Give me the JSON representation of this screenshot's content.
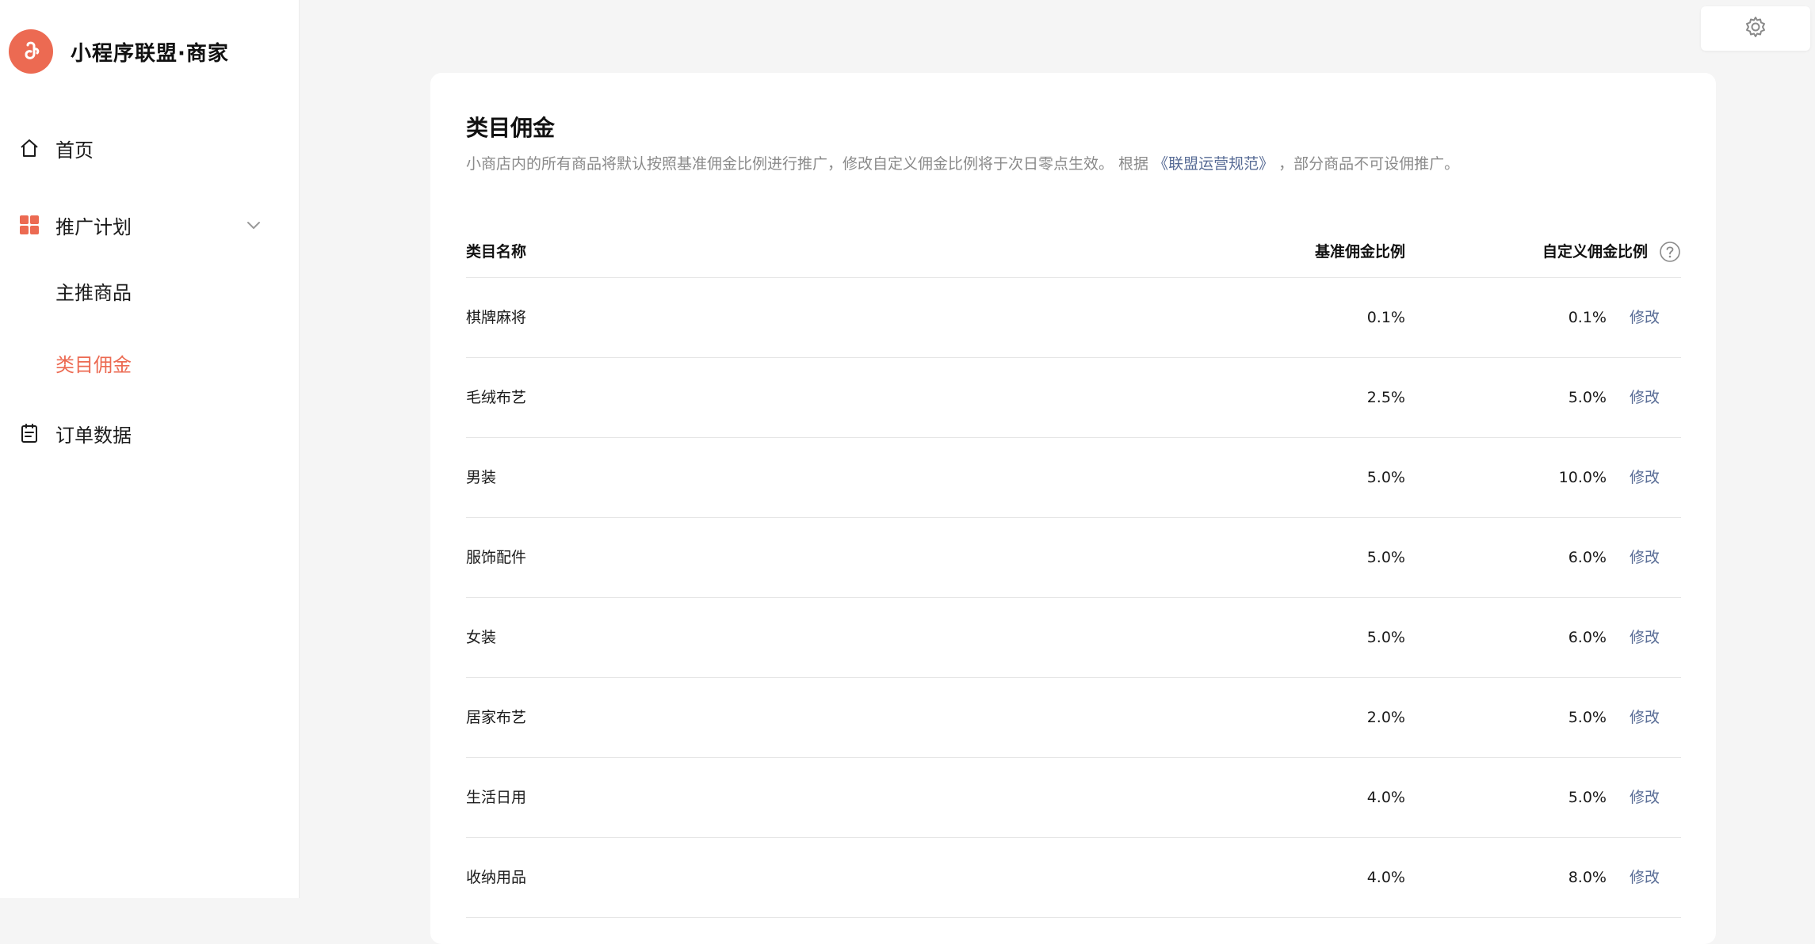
{
  "brand": {
    "name": "小程序联盟·商家"
  },
  "sidebar": {
    "items": [
      {
        "label": "首页"
      },
      {
        "label": "推广计划"
      },
      {
        "label": "主推商品"
      },
      {
        "label": "类目佣金"
      },
      {
        "label": "订单数据"
      }
    ]
  },
  "colors": {
    "accent": "#ec6a52",
    "link": "#576b95"
  },
  "page": {
    "title": "类目佣金",
    "desc_prefix": "小商店内的所有商品将默认按照基准佣金比例进行推广，修改自定义佣金比例将于次日零点生效。 根据",
    "desc_link": "《联盟运营规范》",
    "desc_suffix": "，部分商品不可设佣推广。"
  },
  "table": {
    "headers": {
      "name": "类目名称",
      "base": "基准佣金比例",
      "custom": "自定义佣金比例"
    },
    "rows": [
      {
        "name": "棋牌麻将",
        "base": "0.1%",
        "custom": "0.1%",
        "action": "修改"
      },
      {
        "name": "毛绒布艺",
        "base": "2.5%",
        "custom": "5.0%",
        "action": "修改"
      },
      {
        "name": "男装",
        "base": "5.0%",
        "custom": "10.0%",
        "action": "修改"
      },
      {
        "name": "服饰配件",
        "base": "5.0%",
        "custom": "6.0%",
        "action": "修改"
      },
      {
        "name": "女装",
        "base": "5.0%",
        "custom": "6.0%",
        "action": "修改"
      },
      {
        "name": "居家布艺",
        "base": "2.0%",
        "custom": "5.0%",
        "action": "修改"
      },
      {
        "name": "生活日用",
        "base": "4.0%",
        "custom": "5.0%",
        "action": "修改"
      },
      {
        "name": "收纳用品",
        "base": "4.0%",
        "custom": "8.0%",
        "action": "修改"
      }
    ]
  },
  "icons": {
    "logo": "mini-program-logo-icon",
    "home": "home-icon",
    "promotion": "grid-icon",
    "chevron": "chevron-down-icon",
    "orders": "clipboard-icon",
    "settings": "gear-icon",
    "help": "question-circle-icon"
  }
}
